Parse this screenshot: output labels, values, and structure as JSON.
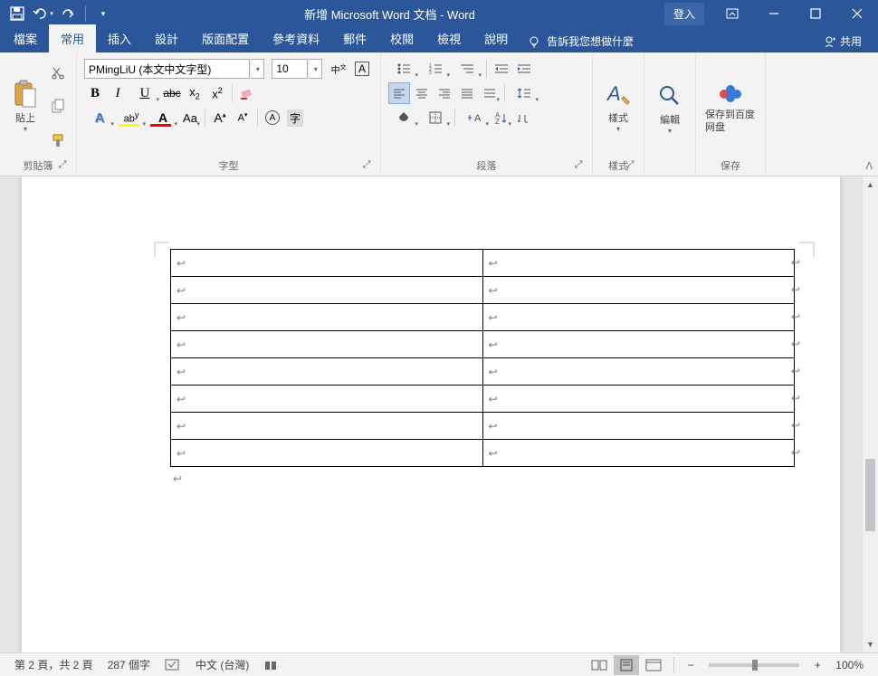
{
  "titlebar": {
    "title": "新增 Microsoft Word 文档  -  Word",
    "login": "登入"
  },
  "tabs": {
    "file": "檔案",
    "home": "常用",
    "insert": "插入",
    "design": "設計",
    "layout": "版面配置",
    "references": "參考資料",
    "mailings": "郵件",
    "review": "校閱",
    "view": "檢視",
    "help": "說明",
    "tellme": "告訴我您想做什麼",
    "share": "共用"
  },
  "ribbon": {
    "clipboard": {
      "paste": "貼上",
      "label": "剪貼簿"
    },
    "font": {
      "name": "PMingLiU (本文中文字型)",
      "size": "10",
      "label": "字型"
    },
    "paragraph": {
      "label": "段落"
    },
    "styles": {
      "btn": "樣式",
      "label": "樣式"
    },
    "editing": {
      "btn": "編輯"
    },
    "baidu": {
      "btn": "保存到百度网盘",
      "label": "保存"
    }
  },
  "table": {
    "rows": 8,
    "cols": 2
  },
  "status": {
    "page": "第 2 頁，共 2 頁",
    "words": "287 個字",
    "lang": "中文 (台灣)",
    "zoom": "100%"
  }
}
